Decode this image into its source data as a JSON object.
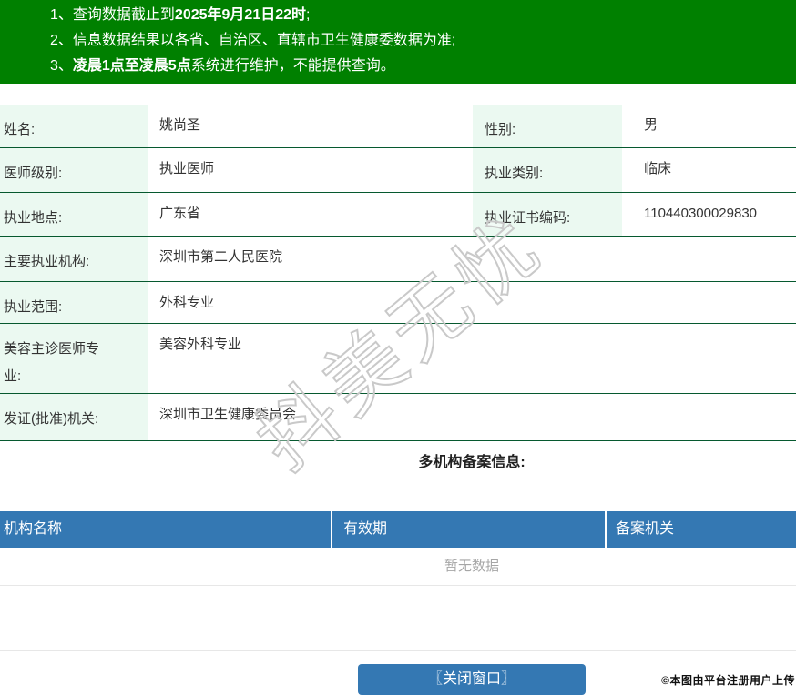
{
  "colors": {
    "banner_green": "#008000",
    "table_border_green": "#06592f",
    "label_cell_mint": "#ebf9f1",
    "accent_blue": "#3478b3",
    "divider_gray": "#e7e7e7"
  },
  "notices": [
    {
      "num": "1、",
      "pre": "查询数据截止到",
      "bold": "2025年9月21日22时",
      "post": ";"
    },
    {
      "num": "2、",
      "pre": "信息数据结果以各省、自治区、直辖市卫生健康委数据为准;",
      "bold": "",
      "post": ""
    },
    {
      "num": "3、",
      "pre": "",
      "bold": "凌晨1点至凌晨5点",
      "post": "系统进行维护，不能提供查询。"
    }
  ],
  "doctor": {
    "rows2col": [
      {
        "label1": "姓名:",
        "value1": "姚尚圣",
        "label2": "性别:",
        "value2": "男"
      },
      {
        "label1": "医师级别:",
        "value1": "执业医师",
        "label2": "执业类别:",
        "value2": "临床"
      },
      {
        "label1": "执业地点:",
        "value1": "广东省",
        "label2": "执业证书编码:",
        "value2": "110440300029830"
      }
    ],
    "rows1col": [
      {
        "label": "主要执业机构:",
        "value": "深圳市第二人民医院"
      },
      {
        "label": "执业范围:",
        "value": "外科专业"
      },
      {
        "label": "美容主诊医师专业:",
        "value": "美容外科专业"
      },
      {
        "label": "发证(批准)机关:",
        "value": "深圳市卫生健康委员会"
      }
    ]
  },
  "filing": {
    "title": "多机构备案信息:",
    "columns": [
      "机构名称",
      "有效期",
      "备案机关"
    ],
    "empty_text": "暂无数据"
  },
  "close_button_label": "〖关闭窗口〗",
  "watermark_text": "抖美无忧",
  "copyright_text": "©本图由平台注册用户上传"
}
